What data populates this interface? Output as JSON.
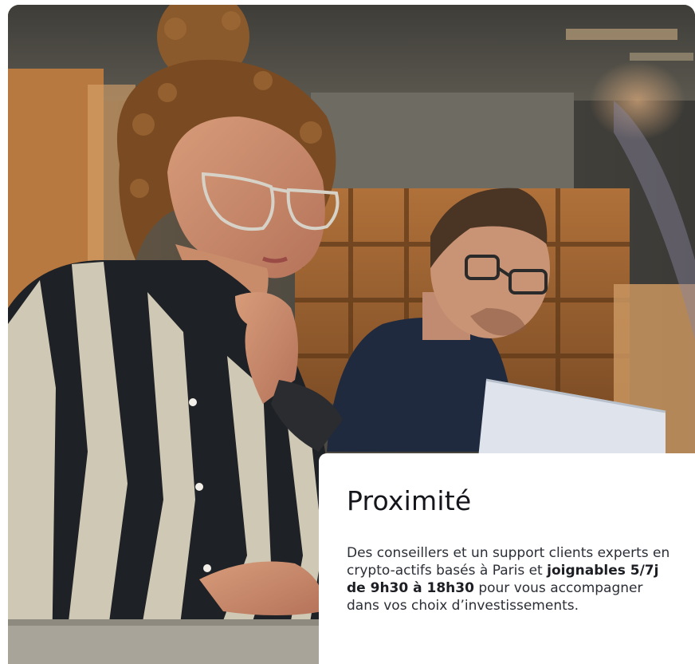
{
  "image": {
    "alt_subject": "woman-with-glasses-at-laptop"
  },
  "card": {
    "title": "Proximité",
    "text_before": "Des conseillers et un support clients experts en crypto-actifs basés à Paris et ",
    "text_bold": "joignables 5/7j de 9h30 à 18h30",
    "text_after": " pour vous accompagner dans vos choix d’investissements."
  }
}
